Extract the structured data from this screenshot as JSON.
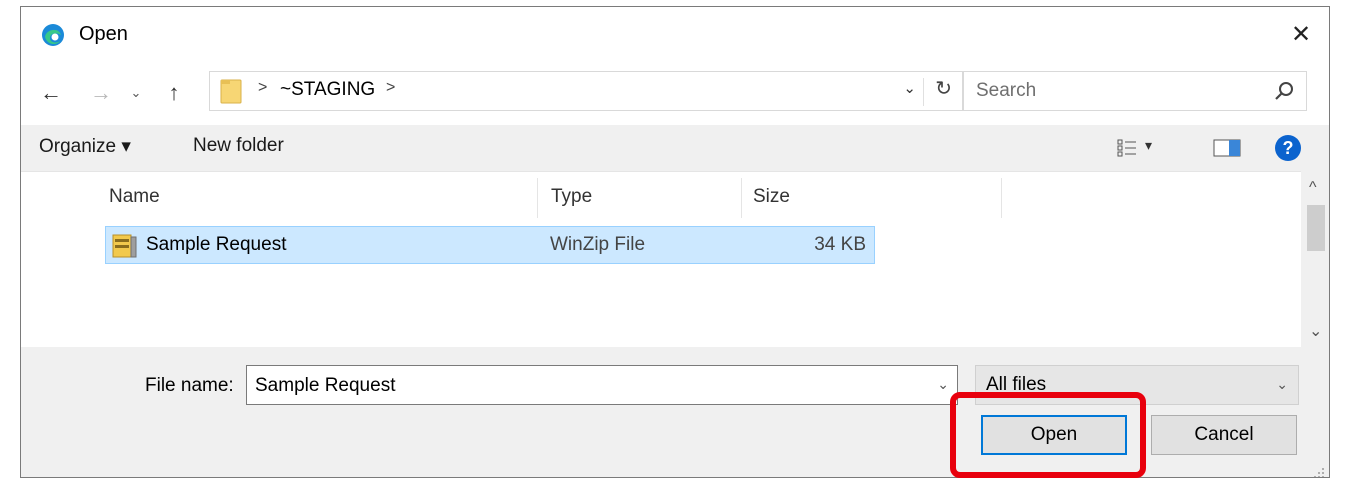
{
  "window": {
    "title": "Open",
    "app_icon": "edge-browser-icon",
    "close_label": "✕"
  },
  "navigation": {
    "back": "←",
    "forward": "→",
    "recent": "⌄",
    "up": "↑",
    "breadcrumb": [
      ">",
      "~STAGING",
      ">"
    ],
    "address_dropdown": "⌄",
    "refresh": "↻",
    "search_placeholder": "Search"
  },
  "toolbar": {
    "organize_label": "Organize ▾",
    "new_folder_label": "New folder",
    "view_caret": "▾",
    "help_label": "?"
  },
  "file_list": {
    "columns": [
      "Name",
      "Type",
      "Size"
    ],
    "rows": [
      {
        "name": "Sample Request",
        "type": "WinZip File",
        "size": "34 KB",
        "selected": true,
        "icon": "winzip-icon"
      }
    ],
    "scroll_up": "^",
    "scroll_down": "⌄"
  },
  "footer": {
    "file_name_label": "File name:",
    "file_name_value": "Sample Request",
    "file_name_caret": "⌄",
    "filter_value": "All files",
    "filter_caret": "⌄",
    "open_label": "Open",
    "cancel_label": "Cancel"
  },
  "colors": {
    "selection": "#cce8ff",
    "accent": "#0078d7",
    "highlight": "#e8000d"
  }
}
